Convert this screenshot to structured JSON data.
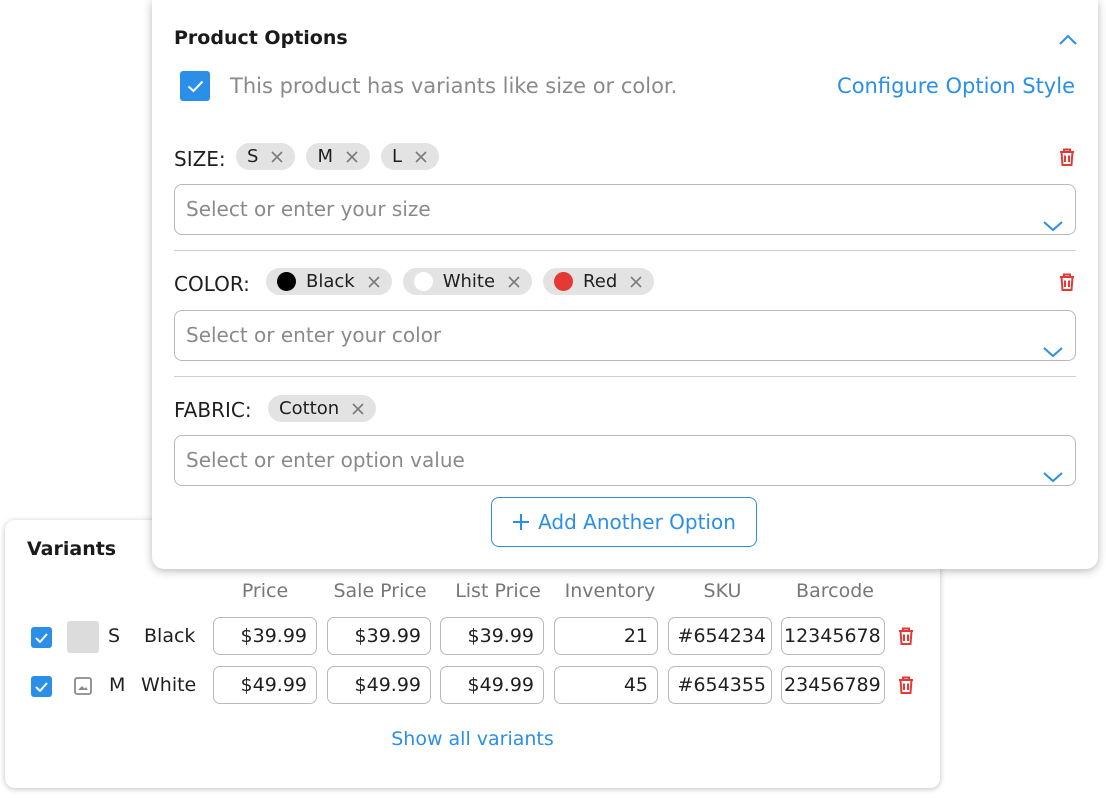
{
  "product_options": {
    "title": "Product Options",
    "has_variants_checked": true,
    "has_variants_label": "This product has variants like size or color.",
    "configure_link": "Configure Option Style",
    "options": [
      {
        "label": "SIZE:",
        "values": [
          {
            "label": "S"
          },
          {
            "label": "M"
          },
          {
            "label": "L"
          }
        ],
        "placeholder": "Select or enter your size",
        "deletable": true
      },
      {
        "label": "COLOR:",
        "values": [
          {
            "label": "Black",
            "swatch": "#000000"
          },
          {
            "label": "White",
            "swatch": "#ffffff"
          },
          {
            "label": "Red",
            "swatch": "#e53935"
          }
        ],
        "placeholder": "Select or enter your color",
        "deletable": true
      },
      {
        "label": "FABRIC:",
        "values": [
          {
            "label": "Cotton"
          }
        ],
        "placeholder": "Select or enter option value",
        "deletable": false
      }
    ],
    "add_button": "Add Another Option"
  },
  "variants": {
    "title": "Variants",
    "columns": [
      "Price",
      "Sale Price",
      "List Price",
      "Inventory",
      "SKU",
      "Barcode"
    ],
    "rows": [
      {
        "checked": true,
        "thumb": "swatch",
        "size": "S",
        "color": "Black",
        "price": "$39.99",
        "sale_price": "$39.99",
        "list_price": "$39.99",
        "inventory": "21",
        "sku": "#654234",
        "barcode": "12345678"
      },
      {
        "checked": true,
        "thumb": "image-placeholder-icon",
        "size": "M",
        "color": "White",
        "price": "$49.99",
        "sale_price": "$49.99",
        "list_price": "$49.99",
        "inventory": "45",
        "sku": "#654355",
        "barcode": "23456789"
      }
    ],
    "show_all": "Show all variants"
  },
  "colors": {
    "accent": "#2b8fe8",
    "danger": "#e53935",
    "chip_bg": "#e3e3e3",
    "muted_text": "#8a8a8a"
  }
}
